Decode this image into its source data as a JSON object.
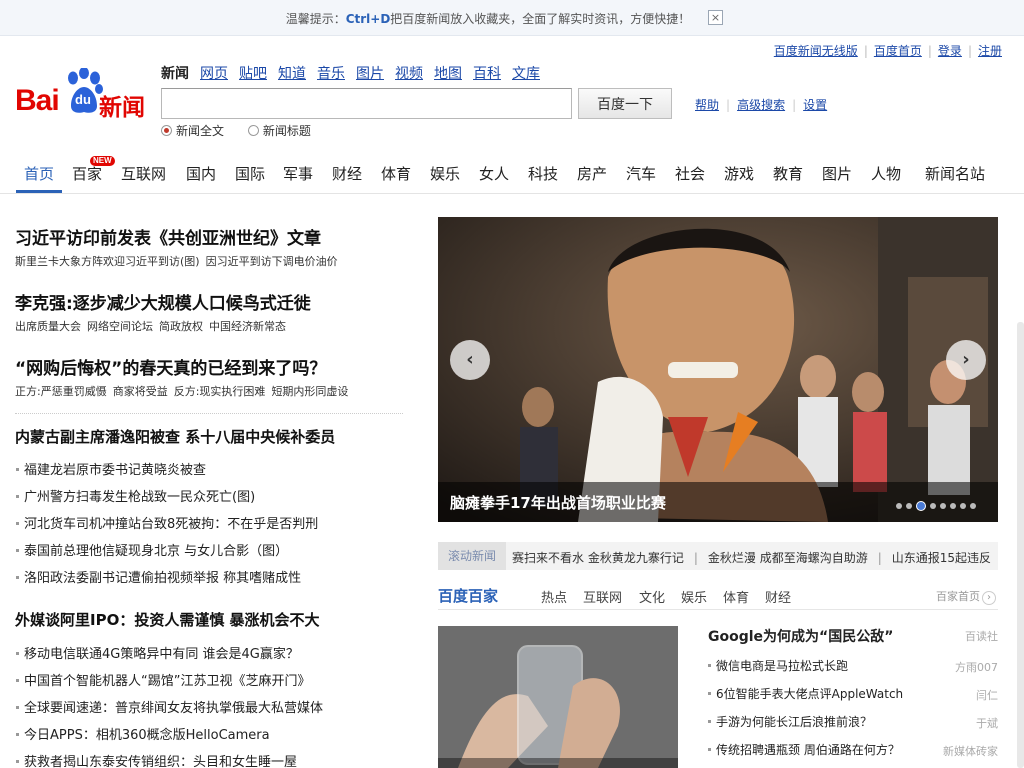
{
  "tip": {
    "prefix": "温馨提示：",
    "shortcut": "Ctrl+D",
    "suffix": "把百度新闻放入收藏夹，全面了解实时资讯，方便快捷！",
    "close": "×"
  },
  "toplinks": [
    "百度新闻无线版",
    "百度首页",
    "登录",
    "注册"
  ],
  "logo": {
    "bai": "Bai",
    "du": "du",
    "news": "新闻"
  },
  "channels": [
    "新闻",
    "网页",
    "贴吧",
    "知道",
    "音乐",
    "图片",
    "视频",
    "地图",
    "百科",
    "文库"
  ],
  "search": {
    "value": "",
    "button": "百度一下"
  },
  "radios": [
    {
      "label": "新闻全文",
      "checked": true
    },
    {
      "label": "新闻标题",
      "checked": false
    }
  ],
  "helplinks": [
    "帮助",
    "高级搜索",
    "设置"
  ],
  "nav": {
    "items": [
      "首页",
      "百家",
      "互联网",
      "国内",
      "国际",
      "军事",
      "财经",
      "体育",
      "娱乐",
      "女人",
      "科技",
      "房产",
      "汽车",
      "社会",
      "游戏",
      "教育",
      "图片",
      "人物",
      "新闻名站"
    ],
    "badge": "NEW"
  },
  "headlines": [
    {
      "title": "习近平访印前发表《共创亚洲世纪》文章",
      "subs": [
        "斯里兰卡大象方阵欢迎习近平到访(图)",
        "因习近平到访下调电价油价"
      ]
    },
    {
      "title": "李克强:逐步减少大规模人口候鸟式迁徙",
      "subs": [
        "出席质量大会",
        "网络空间论坛",
        "简政放权",
        "中国经济新常态"
      ]
    },
    {
      "title": "“网购后悔权”的春天真的已经到来了吗？",
      "subs": [
        "正方:严惩重罚威慑",
        "商家将受益",
        "反方:现实执行困难",
        "短期内形同虚设"
      ]
    }
  ],
  "section2": {
    "title": "内蒙古副主席潘逸阳被查 系十八届中央候补委员",
    "items": [
      "福建龙岩原市委书记黄晓炎被查",
      "广州警方扫毒发生枪战致一民众死亡(图)",
      "河北货车司机冲撞站台致8死被拘：不在乎是否判刑",
      "泰国前总理他信疑现身北京 与女儿合影（图）",
      "洛阳政法委副书记遭偷拍视频举报 称其嗜赌成性"
    ]
  },
  "section3": {
    "title": "外媒谈阿里IPO：投资人需谨慎 暴涨机会不大",
    "items": [
      "移动电信联通4G策略异中有同 谁会是4G赢家？",
      "中国首个智能机器人“踢馆”江苏卫视《芝麻开门》",
      "全球要闻速递：普京绯闻女友将执掌俄最大私营媒体",
      "今日APPS：相机360概念版HelloCamera",
      "获救者揭山东泰安传销组织：头目和女生睡一屋"
    ]
  },
  "slider": {
    "caption": "脑瘫拳手17年出战首场职业比赛",
    "dots": 8,
    "active": 2,
    "prev": "‹",
    "next": "›"
  },
  "ticker": {
    "label": "滚动新闻",
    "items": [
      "赛扫来不看水 金秋黄龙九寨行记",
      "金秋烂漫 成都至海螺沟自助游",
      "山东通报15起违反"
    ]
  },
  "baijia": {
    "title": "百度百家",
    "tabs": [
      "热点",
      "互联网",
      "文化",
      "娱乐",
      "体育",
      "财经"
    ],
    "home": "百家首页",
    "home_icon": "›",
    "list": [
      {
        "title": "Google为何成为“国民公敌”",
        "source": "百读社"
      },
      {
        "title": "微信电商是马拉松式长跑",
        "source": "方雨007"
      },
      {
        "title": "6位智能手表大佬点评AppleWatch",
        "source": "闫仁"
      },
      {
        "title": "手游为何能长江后浪推前浪？",
        "source": "于斌"
      },
      {
        "title": "传统招聘遇瓶颈 周伯通路在何方？",
        "source": "新媒体砖家"
      }
    ]
  },
  "colors": {
    "brand": "#e10602",
    "link": "#1c49a8",
    "accent": "#2b62b7"
  }
}
